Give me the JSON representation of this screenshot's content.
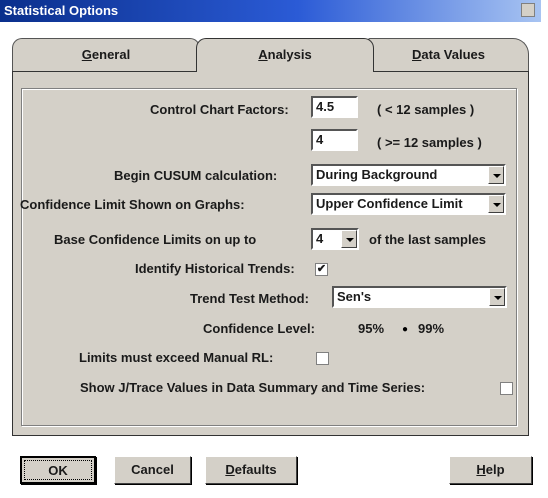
{
  "window": {
    "title": "Statistical Options"
  },
  "tabs": [
    {
      "label": "General",
      "underline": "G",
      "rest": "eneral"
    },
    {
      "label": "Analysis",
      "underline": "A",
      "rest": "nalysis"
    },
    {
      "label": "Data Values",
      "underline": "D",
      "rest": "ata Values"
    }
  ],
  "active_tab": "Analysis",
  "form": {
    "control_chart_factors_label": "Control Chart Factors:",
    "factor_lt12_value": "4.5",
    "factor_lt12_hint": "( < 12 samples )",
    "factor_ge12_value": "4",
    "factor_ge12_hint": "( >= 12 samples )",
    "cusum_label": "Begin CUSUM calculation:",
    "cusum_value": "During Background",
    "conf_limit_label": "Confidence Limit Shown on Graphs:",
    "conf_limit_value": "Upper Confidence Limit",
    "base_conf_label": "Base Confidence Limits on up to",
    "base_conf_value": "4",
    "base_conf_suffix": "of the last samples",
    "historical_trends_label": "Identify Historical Trends:",
    "historical_trends_checked": true,
    "trend_test_label": "Trend Test Method:",
    "trend_test_value": "Sen's",
    "confidence_level_label": "Confidence Level:",
    "confidence_level_options": [
      "95%",
      "99%"
    ],
    "confidence_level_selected": "99%",
    "limits_exceed_label": "Limits must exceed Manual RL:",
    "limits_exceed_checked": false,
    "show_jtrace_label": "Show J/Trace Values in Data Summary and Time Series:",
    "show_jtrace_checked": false
  },
  "buttons": {
    "ok": "OK",
    "cancel": "Cancel",
    "defaults_u": "D",
    "defaults_rest": "efaults",
    "help_u": "H",
    "help_rest": "elp"
  }
}
